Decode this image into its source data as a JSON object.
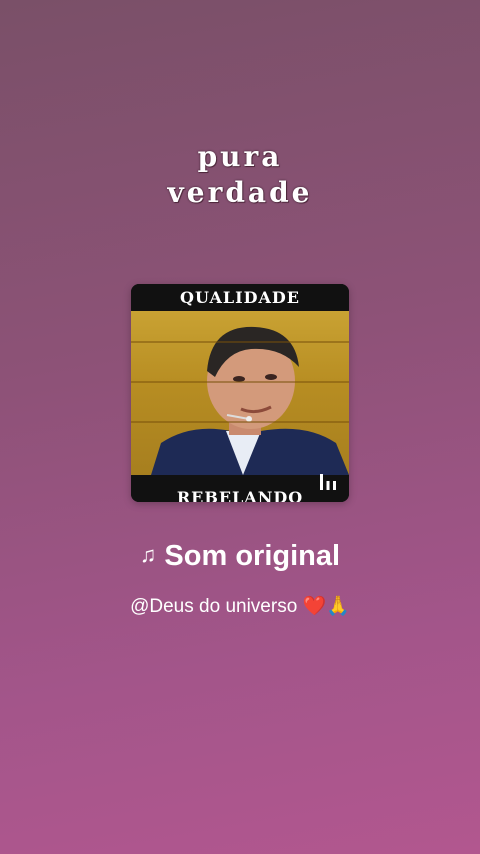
{
  "caption": {
    "line1": "pura",
    "line2": "verdade"
  },
  "card": {
    "top_banner": "QUALIDADE",
    "bottom_banner": "REBELANDO",
    "equalizer_icon": "equalizer-icon"
  },
  "audio": {
    "note_icon": "♫",
    "title": "Som original",
    "author": "@Deus do universo",
    "author_emoji_1": "❤️",
    "author_emoji_2": "🙏"
  }
}
